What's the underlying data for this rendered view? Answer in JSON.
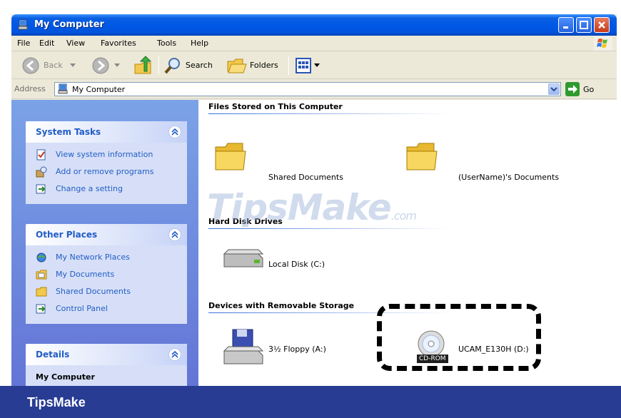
{
  "window": {
    "title": "My Computer"
  },
  "menu": {
    "items": [
      "File",
      "Edit",
      "View",
      "Favorites",
      "Tools",
      "Help"
    ]
  },
  "toolbar": {
    "back_label": "Back",
    "search_label": "Search",
    "folders_label": "Folders"
  },
  "address": {
    "label": "Address",
    "value": "My Computer",
    "go_label": "Go"
  },
  "sidebar": {
    "system_tasks": {
      "title": "System Tasks",
      "items": [
        {
          "label": "View system information",
          "icon": "system-info-icon"
        },
        {
          "label": "Add or remove programs",
          "icon": "add-remove-programs-icon"
        },
        {
          "label": "Change a setting",
          "icon": "control-panel-icon"
        }
      ]
    },
    "other_places": {
      "title": "Other Places",
      "items": [
        {
          "label": "My Network Places",
          "icon": "network-places-icon"
        },
        {
          "label": "My Documents",
          "icon": "my-documents-icon"
        },
        {
          "label": "Shared Documents",
          "icon": "folder-icon"
        },
        {
          "label": "Control Panel",
          "icon": "control-panel-icon"
        }
      ]
    },
    "details": {
      "title": "Details",
      "value": "My Computer"
    }
  },
  "content": {
    "files_group": {
      "title": "Files Stored on This Computer",
      "items": [
        "Shared Documents",
        "(UserName)'s Documents"
      ]
    },
    "hdd_group": {
      "title": "Hard Disk Drives",
      "items": [
        "Local Disk (C:)"
      ]
    },
    "removable_group": {
      "title": "Devices with Removable Storage",
      "items": [
        "3½ Floppy (A:)",
        "UCAM_E130H (D:)"
      ],
      "cd_badge": "CD-ROM"
    }
  },
  "watermark": {
    "text": "TipsMake",
    "suffix": ".com"
  },
  "footer": {
    "brand": "TipsMake"
  },
  "colors": {
    "titlebar": "#0058e6",
    "sidebar_bg": "#7ba2e7",
    "link": "#215dc6",
    "footer": "#283c93"
  }
}
